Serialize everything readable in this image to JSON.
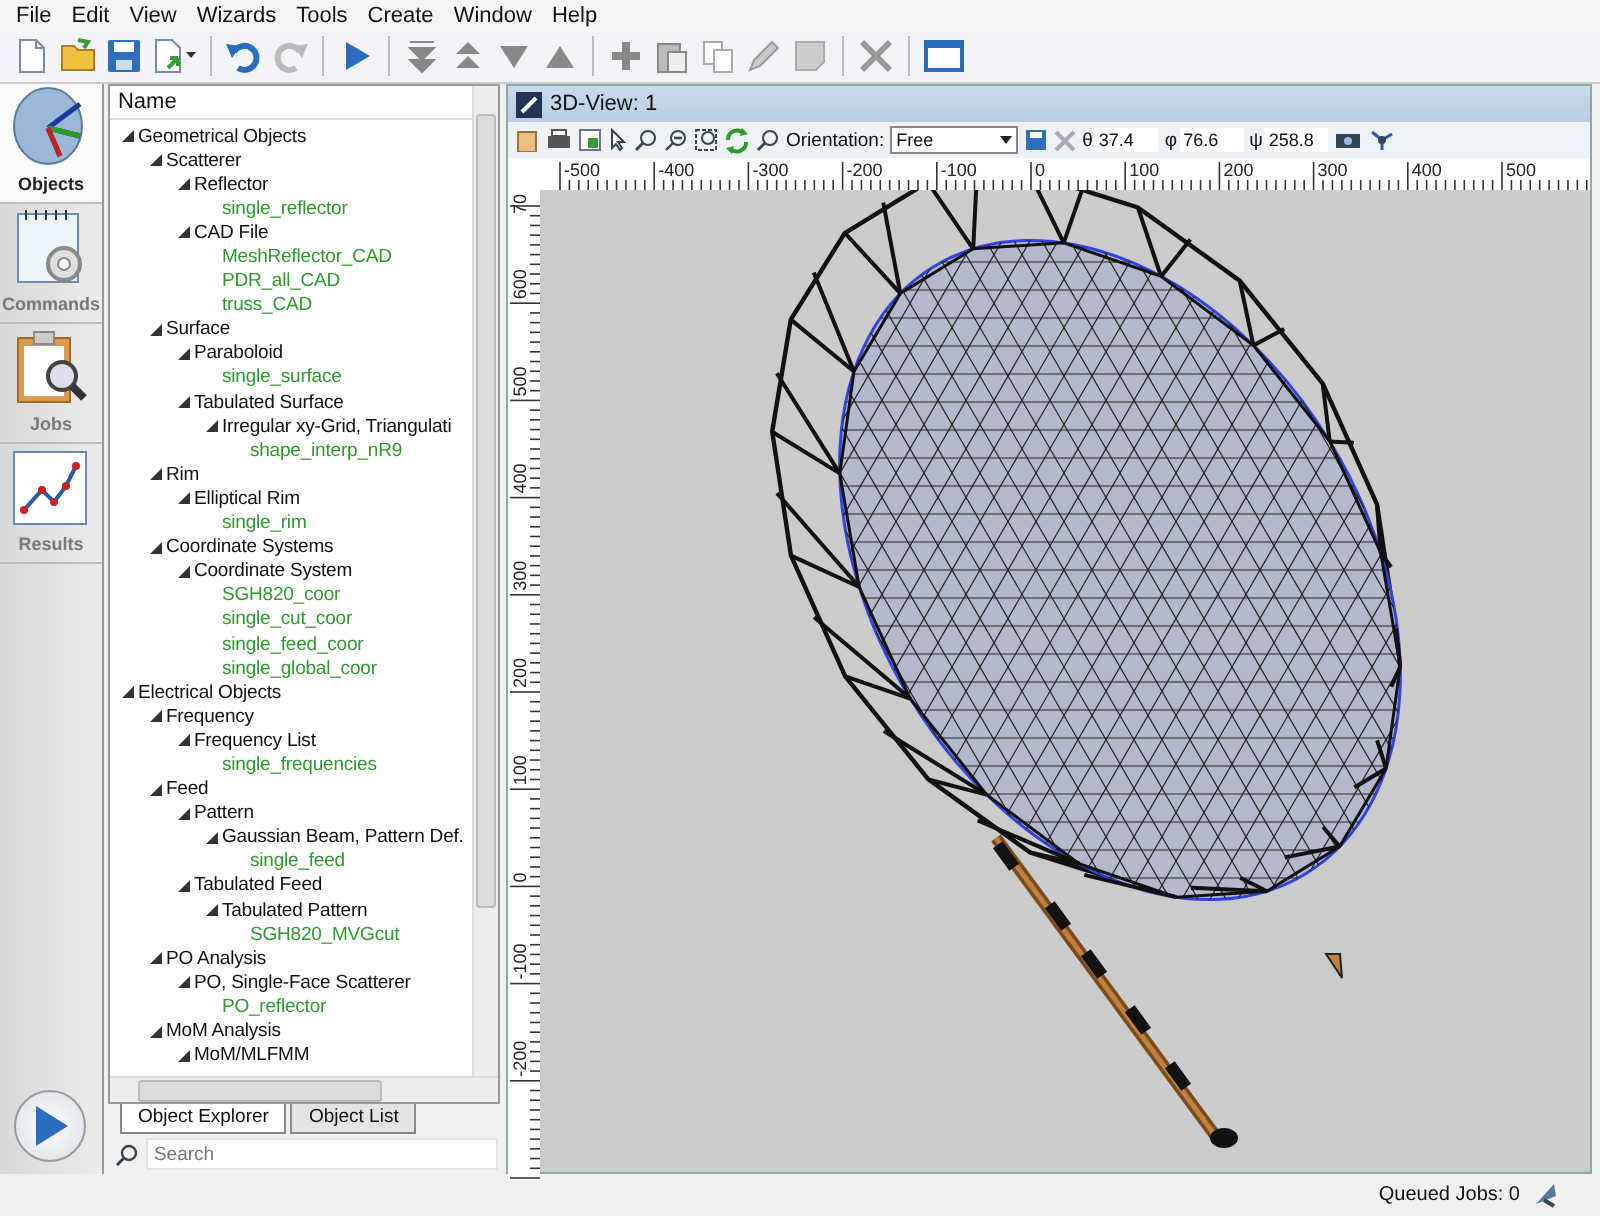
{
  "menu": [
    "File",
    "Edit",
    "View",
    "Wizards",
    "Tools",
    "Create",
    "Window",
    "Help"
  ],
  "toolbar": [
    {
      "kind": "new"
    },
    {
      "kind": "open"
    },
    {
      "kind": "save"
    },
    {
      "kind": "export"
    },
    {
      "kind": "sep"
    },
    {
      "kind": "undo"
    },
    {
      "kind": "redo"
    },
    {
      "kind": "sep"
    },
    {
      "kind": "run"
    },
    {
      "kind": "sep"
    },
    {
      "kind": "bottom"
    },
    {
      "kind": "top"
    },
    {
      "kind": "down"
    },
    {
      "kind": "up"
    },
    {
      "kind": "sep"
    },
    {
      "kind": "add"
    },
    {
      "kind": "paste"
    },
    {
      "kind": "copy"
    },
    {
      "kind": "edit"
    },
    {
      "kind": "blank"
    },
    {
      "kind": "sep"
    },
    {
      "kind": "delete"
    },
    {
      "kind": "sep"
    },
    {
      "kind": "window"
    }
  ],
  "nav": [
    {
      "label": "Objects",
      "kind": "objects",
      "selected": true
    },
    {
      "label": "Commands",
      "kind": "commands",
      "selected": false
    },
    {
      "label": "Jobs",
      "kind": "jobs",
      "selected": false
    },
    {
      "label": "Results",
      "kind": "results",
      "selected": false
    }
  ],
  "tree": {
    "header": "Name",
    "items": [
      {
        "label": "Geometrical Objects",
        "kind": "folder",
        "expanded": true,
        "children": [
          {
            "label": "Scatterer",
            "kind": "folder",
            "expanded": true,
            "children": [
              {
                "label": "Reflector",
                "kind": "folder",
                "expanded": true,
                "children": [
                  {
                    "label": "single_reflector",
                    "kind": "object"
                  }
                ]
              },
              {
                "label": "CAD File",
                "kind": "folder",
                "expanded": true,
                "children": [
                  {
                    "label": "MeshReflector_CAD",
                    "kind": "object"
                  },
                  {
                    "label": "PDR_all_CAD",
                    "kind": "object"
                  },
                  {
                    "label": "truss_CAD",
                    "kind": "object"
                  }
                ]
              }
            ]
          },
          {
            "label": "Surface",
            "kind": "folder",
            "expanded": true,
            "children": [
              {
                "label": "Paraboloid",
                "kind": "folder",
                "expanded": true,
                "children": [
                  {
                    "label": "single_surface",
                    "kind": "object"
                  }
                ]
              },
              {
                "label": "Tabulated Surface",
                "kind": "folder",
                "expanded": true,
                "children": [
                  {
                    "label": "Irregular xy-Grid, Triangulati",
                    "kind": "folder",
                    "expanded": true,
                    "children": [
                      {
                        "label": "shape_interp_nR9",
                        "kind": "object"
                      }
                    ]
                  }
                ]
              }
            ]
          },
          {
            "label": "Rim",
            "kind": "folder",
            "expanded": true,
            "children": [
              {
                "label": "Elliptical Rim",
                "kind": "folder",
                "expanded": true,
                "children": [
                  {
                    "label": "single_rim",
                    "kind": "object"
                  }
                ]
              }
            ]
          },
          {
            "label": "Coordinate Systems",
            "kind": "folder",
            "expanded": true,
            "children": [
              {
                "label": "Coordinate System",
                "kind": "folder",
                "expanded": true,
                "children": [
                  {
                    "label": "SGH820_coor",
                    "kind": "object"
                  },
                  {
                    "label": "single_cut_coor",
                    "kind": "object"
                  },
                  {
                    "label": "single_feed_coor",
                    "kind": "object"
                  },
                  {
                    "label": "single_global_coor",
                    "kind": "object"
                  }
                ]
              }
            ]
          }
        ]
      },
      {
        "label": "Electrical Objects",
        "kind": "folder",
        "expanded": true,
        "children": [
          {
            "label": "Frequency",
            "kind": "folder",
            "expanded": true,
            "children": [
              {
                "label": "Frequency List",
                "kind": "folder",
                "expanded": true,
                "children": [
                  {
                    "label": "single_frequencies",
                    "kind": "object"
                  }
                ]
              }
            ]
          },
          {
            "label": "Feed",
            "kind": "folder",
            "expanded": true,
            "children": [
              {
                "label": "Pattern",
                "kind": "folder",
                "expanded": true,
                "children": [
                  {
                    "label": "Gaussian Beam, Pattern Def.",
                    "kind": "folder",
                    "expanded": true,
                    "children": [
                      {
                        "label": "single_feed",
                        "kind": "object"
                      }
                    ]
                  }
                ]
              },
              {
                "label": "Tabulated Feed",
                "kind": "folder",
                "expanded": true,
                "children": [
                  {
                    "label": "Tabulated Pattern",
                    "kind": "folder",
                    "expanded": true,
                    "children": [
                      {
                        "label": "SGH820_MVGcut",
                        "kind": "object"
                      }
                    ]
                  }
                ]
              }
            ]
          },
          {
            "label": "PO Analysis",
            "kind": "folder",
            "expanded": true,
            "children": [
              {
                "label": "PO, Single-Face Scatterer",
                "kind": "folder",
                "expanded": true,
                "children": [
                  {
                    "label": "PO_reflector",
                    "kind": "object"
                  }
                ]
              }
            ]
          },
          {
            "label": "MoM Analysis",
            "kind": "folder",
            "expanded": true,
            "children": [
              {
                "label": "MoM/MLFMM",
                "kind": "folder",
                "expanded": true
              }
            ]
          }
        ]
      }
    ]
  },
  "panel_tabs": [
    {
      "label": "Object Explorer",
      "selected": true
    },
    {
      "label": "Object List",
      "selected": false
    }
  ],
  "search": {
    "placeholder": "Search"
  },
  "view": {
    "title": "3D-View: 1",
    "orientation_label": "Orientation:",
    "orientation_value": "Free",
    "angles": [
      {
        "symbol": "θ",
        "value": "37.4"
      },
      {
        "symbol": "φ",
        "value": "76.6"
      },
      {
        "symbol": "ψ",
        "value": "258.8"
      }
    ],
    "x_ruler": [
      "-500",
      "-400",
      "-300",
      "-200",
      "-100",
      "0",
      "100",
      "200",
      "300",
      "400",
      "500"
    ],
    "y_ruler": [
      "70",
      "600",
      "500",
      "400",
      "300",
      "200",
      "100",
      "0",
      "-100",
      "-200"
    ]
  },
  "status_bar": {
    "queued_jobs": "Queued Jobs: 0"
  }
}
